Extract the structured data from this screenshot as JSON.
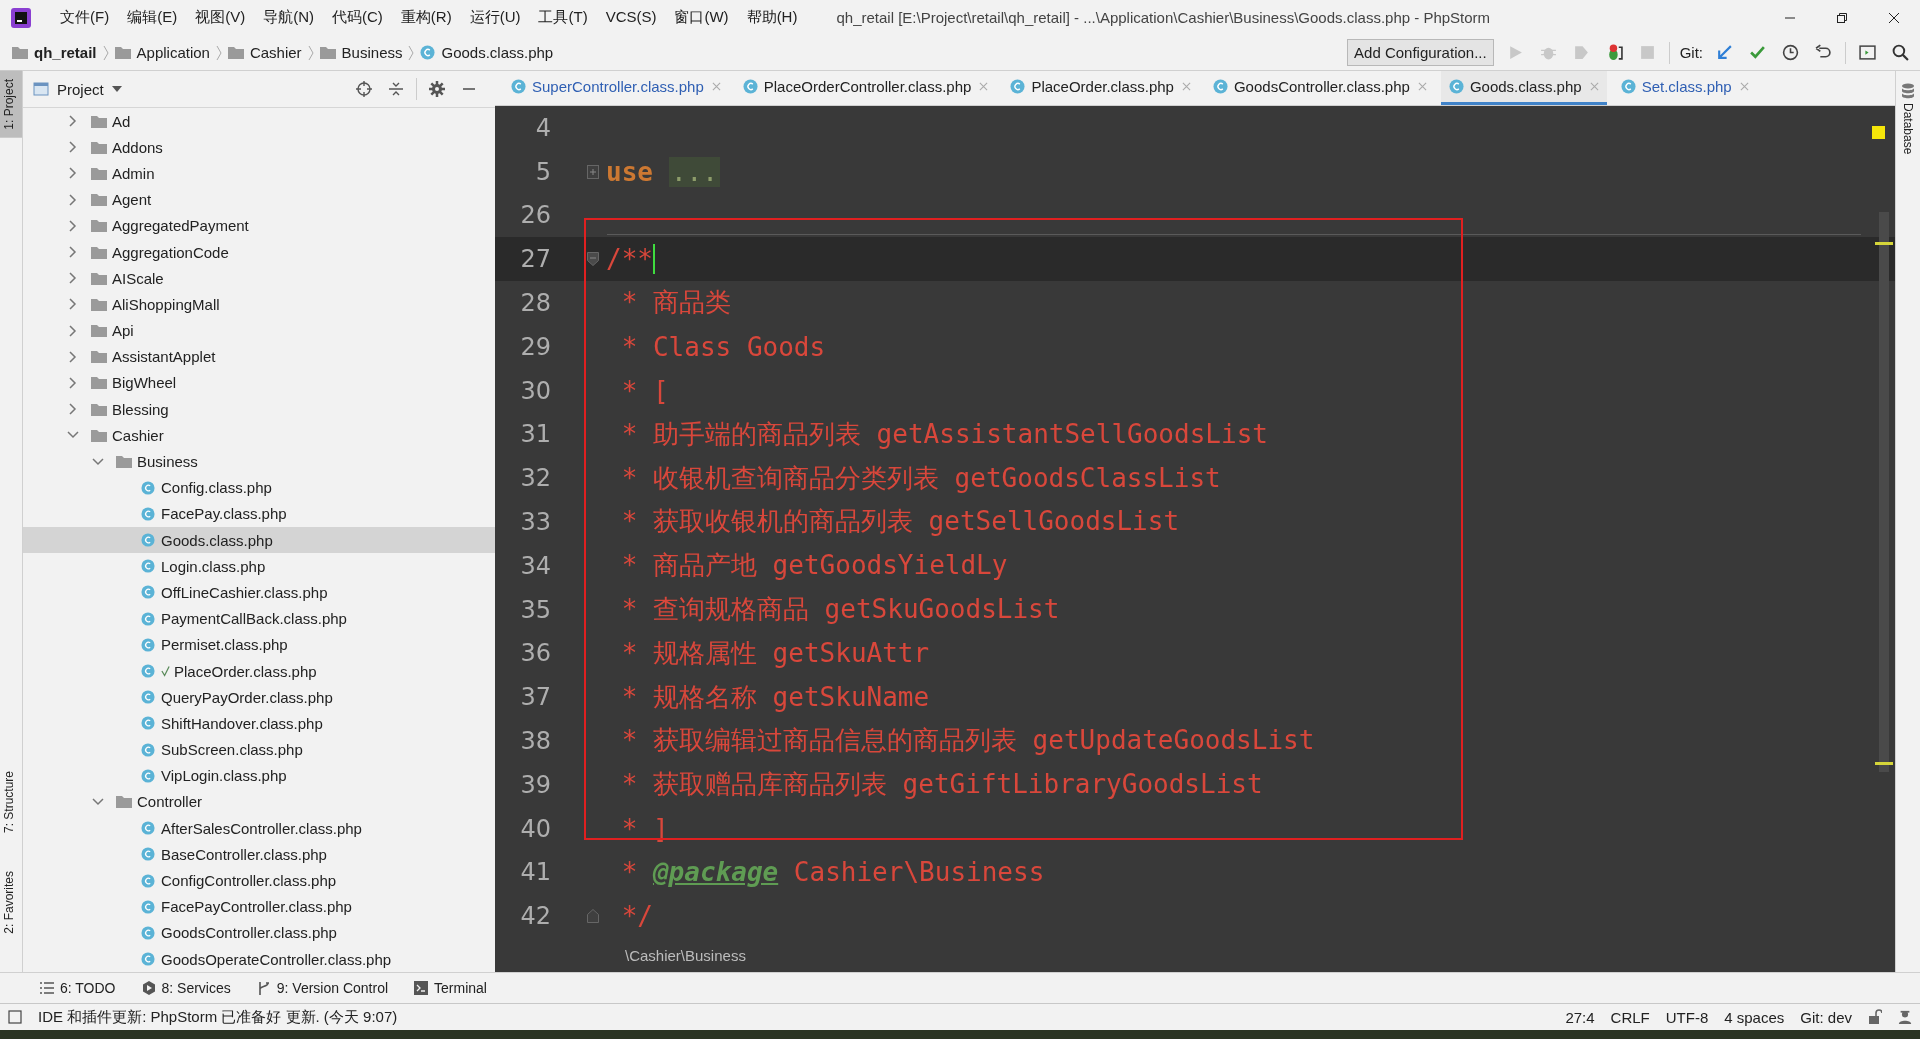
{
  "window": {
    "title": "qh_retail [E:\\Project\\retail\\qh_retail] - ...\\Application\\Cashier\\Business\\Goods.class.php - PhpStorm"
  },
  "menu": [
    "文件(F)",
    "编辑(E)",
    "视图(V)",
    "导航(N)",
    "代码(C)",
    "重构(R)",
    "运行(U)",
    "工具(T)",
    "VCS(S)",
    "窗口(W)",
    "帮助(H)"
  ],
  "breadcrumb": [
    {
      "label": "qh_retail",
      "kind": "folder"
    },
    {
      "label": "Application",
      "kind": "folder"
    },
    {
      "label": "Cashier",
      "kind": "folder"
    },
    {
      "label": "Business",
      "kind": "folder"
    },
    {
      "label": "Goods.class.php",
      "kind": "file"
    }
  ],
  "toolbar": {
    "run_config": "Add Configuration...",
    "git_label": "Git:"
  },
  "side_tabs_left": [
    {
      "label": "1: Project",
      "selected": true
    },
    {
      "label": "7: Structure",
      "selected": false
    },
    {
      "label": "2: Favorites",
      "selected": false
    }
  ],
  "side_tabs_right": [
    {
      "label": "Database",
      "selected": false
    }
  ],
  "project_panel": {
    "title": "Project"
  },
  "tree": [
    {
      "name": "Ad",
      "kind": "folder",
      "expanded": false,
      "selected": false
    },
    {
      "name": "Addons",
      "kind": "folder",
      "expanded": false,
      "selected": false
    },
    {
      "name": "Admin",
      "kind": "folder",
      "expanded": false,
      "selected": false
    },
    {
      "name": "Agent",
      "kind": "folder",
      "expanded": false,
      "selected": false
    },
    {
      "name": "AggregatedPayment",
      "kind": "folder",
      "expanded": false,
      "selected": false
    },
    {
      "name": "AggregationCode",
      "kind": "folder",
      "expanded": false,
      "selected": false
    },
    {
      "name": "AIScale",
      "kind": "folder",
      "expanded": false,
      "selected": false
    },
    {
      "name": "AliShoppingMall",
      "kind": "folder",
      "expanded": false,
      "selected": false
    },
    {
      "name": "Api",
      "kind": "folder",
      "expanded": false,
      "selected": false
    },
    {
      "name": "AssistantApplet",
      "kind": "folder",
      "expanded": false,
      "selected": false
    },
    {
      "name": "BigWheel",
      "kind": "folder",
      "expanded": false,
      "selected": false
    },
    {
      "name": "Blessing",
      "kind": "folder",
      "expanded": false,
      "selected": false
    },
    {
      "name": "Cashier",
      "kind": "folder",
      "expanded": true,
      "selected": false,
      "children": [
        {
          "name": "Business",
          "kind": "folder",
          "expanded": true,
          "selected": false,
          "children": [
            {
              "name": "Config.class.php",
              "kind": "file",
              "selected": false,
              "checked": false
            },
            {
              "name": "FacePay.class.php",
              "kind": "file",
              "selected": false,
              "checked": false
            },
            {
              "name": "Goods.class.php",
              "kind": "file",
              "selected": true,
              "checked": false
            },
            {
              "name": "Login.class.php",
              "kind": "file",
              "selected": false,
              "checked": false
            },
            {
              "name": "OffLineCashier.class.php",
              "kind": "file",
              "selected": false,
              "checked": false
            },
            {
              "name": "PaymentCallBack.class.php",
              "kind": "file",
              "selected": false,
              "checked": false
            },
            {
              "name": "Permiset.class.php",
              "kind": "file",
              "selected": false,
              "checked": false
            },
            {
              "name": "PlaceOrder.class.php",
              "kind": "file",
              "selected": false,
              "checked": true
            },
            {
              "name": "QueryPayOrder.class.php",
              "kind": "file",
              "selected": false,
              "checked": false
            },
            {
              "name": "ShiftHandover.class.php",
              "kind": "file",
              "selected": false,
              "checked": false
            },
            {
              "name": "SubScreen.class.php",
              "kind": "file",
              "selected": false,
              "checked": false
            },
            {
              "name": "VipLogin.class.php",
              "kind": "file",
              "selected": false,
              "checked": false
            }
          ]
        },
        {
          "name": "Controller",
          "kind": "folder",
          "expanded": true,
          "selected": false,
          "children": [
            {
              "name": "AfterSalesController.class.php",
              "kind": "file",
              "selected": false,
              "checked": false
            },
            {
              "name": "BaseController.class.php",
              "kind": "file",
              "selected": false,
              "checked": false
            },
            {
              "name": "ConfigController.class.php",
              "kind": "file",
              "selected": false,
              "checked": false
            },
            {
              "name": "FacePayController.class.php",
              "kind": "file",
              "selected": false,
              "checked": false
            },
            {
              "name": "GoodsController.class.php",
              "kind": "file",
              "selected": false,
              "checked": false
            },
            {
              "name": "GoodsOperateController.class.php",
              "kind": "file",
              "selected": false,
              "checked": false
            }
          ]
        }
      ]
    }
  ],
  "tabs": [
    {
      "label": "SuperController.class.php",
      "selected": false,
      "modified": true
    },
    {
      "label": "PlaceOrderController.class.php",
      "selected": false,
      "modified": false
    },
    {
      "label": "PlaceOrder.class.php",
      "selected": false,
      "modified": false
    },
    {
      "label": "GoodsController.class.php",
      "selected": false,
      "modified": false
    },
    {
      "label": "Goods.class.php",
      "selected": true,
      "modified": false
    },
    {
      "label": "Set.class.php",
      "selected": false,
      "modified": true
    }
  ],
  "code": [
    {
      "number": "4",
      "kind": "plain",
      "current": false
    },
    {
      "number": "5",
      "kind": "collapsed",
      "current": false,
      "segments": [
        {
          "kind": "keyword",
          "text": "use"
        },
        {
          "kind": "folded",
          "text": "..."
        }
      ]
    },
    {
      "number": "26",
      "kind": "plain",
      "current": false
    },
    {
      "number": "27",
      "kind": "foldstart",
      "current": true,
      "segments": [
        {
          "kind": "comment",
          "text": "/**"
        }
      ]
    },
    {
      "number": "28",
      "kind": "plain",
      "current": false,
      "segments": [
        {
          "kind": "comment",
          "text": " * 商品类"
        }
      ]
    },
    {
      "number": "29",
      "kind": "plain",
      "current": false,
      "segments": [
        {
          "kind": "comment",
          "text": " * Class Goods"
        }
      ]
    },
    {
      "number": "30",
      "kind": "plain",
      "current": false,
      "segments": [
        {
          "kind": "comment",
          "text": " * ["
        }
      ]
    },
    {
      "number": "31",
      "kind": "plain",
      "current": false,
      "segments": [
        {
          "kind": "comment",
          "text": " * 助手端的商品列表 getAssistantSellGoodsList"
        }
      ]
    },
    {
      "number": "32",
      "kind": "plain",
      "current": false,
      "segments": [
        {
          "kind": "comment",
          "text": " * 收银机查询商品分类列表 getGoodsClassList"
        }
      ]
    },
    {
      "number": "33",
      "kind": "plain",
      "current": false,
      "segments": [
        {
          "kind": "comment",
          "text": " * 获取收银机的商品列表 getSellGoodsList"
        }
      ]
    },
    {
      "number": "34",
      "kind": "plain",
      "current": false,
      "segments": [
        {
          "kind": "comment",
          "text": " * 商品产地 getGoodsYieldLy"
        }
      ]
    },
    {
      "number": "35",
      "kind": "plain",
      "current": false,
      "segments": [
        {
          "kind": "comment",
          "text": " * 查询规格商品 getSkuGoodsList"
        }
      ]
    },
    {
      "number": "36",
      "kind": "plain",
      "current": false,
      "segments": [
        {
          "kind": "comment",
          "text": " * 规格属性 getSkuAttr"
        }
      ]
    },
    {
      "number": "37",
      "kind": "plain",
      "current": false,
      "segments": [
        {
          "kind": "comment",
          "text": " * 规格名称 getSkuName"
        }
      ]
    },
    {
      "number": "38",
      "kind": "plain",
      "current": false,
      "segments": [
        {
          "kind": "comment",
          "text": " * 获取编辑过商品信息的商品列表 getUpdateGoodsList"
        }
      ]
    },
    {
      "number": "39",
      "kind": "plain",
      "current": false,
      "segments": [
        {
          "kind": "comment",
          "text": " * 获取赠品库商品列表 getGiftLibraryGoodsList"
        }
      ]
    },
    {
      "number": "40",
      "kind": "plain",
      "current": false,
      "segments": [
        {
          "kind": "comment",
          "text": " * ]"
        }
      ]
    },
    {
      "number": "41",
      "kind": "plain",
      "current": false,
      "segments": [
        {
          "kind": "comment",
          "text": " * "
        },
        {
          "kind": "doc-tag",
          "text": "@package"
        },
        {
          "kind": "comment",
          "text": " Cashier\\Business"
        }
      ]
    },
    {
      "number": "42",
      "kind": "foldend",
      "current": false,
      "segments": [
        {
          "kind": "comment",
          "text": " */"
        }
      ]
    }
  ],
  "editor_breadcrumb": "\\Cashier\\Business",
  "bottom_tools": [
    {
      "label": "6: TODO",
      "kind": "todo"
    },
    {
      "label": "8: Services",
      "kind": "services"
    },
    {
      "label": "9: Version Control",
      "kind": "vcs"
    },
    {
      "label": "Terminal",
      "kind": "terminal"
    }
  ],
  "status_bar": {
    "message": "IDE 和插件更新: PhpStorm 已准备好 更新. (今天 9:07)",
    "items": [
      "27:4",
      "CRLF",
      "UTF-8",
      "4 spaces",
      "Git: dev"
    ]
  }
}
